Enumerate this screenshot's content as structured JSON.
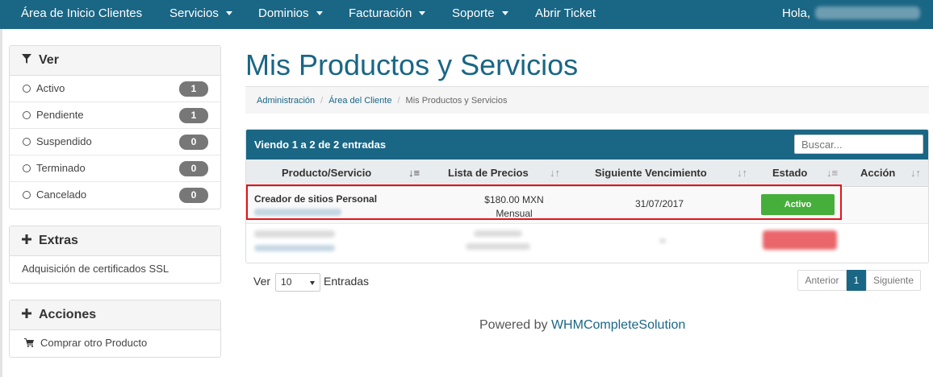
{
  "nav": {
    "home": "Área de Inicio Clientes",
    "services": "Servicios",
    "domains": "Dominios",
    "billing": "Facturación",
    "support": "Soporte",
    "open_ticket": "Abrir Ticket",
    "greeting": "Hola,"
  },
  "sidebar": {
    "view": {
      "title": "Ver",
      "filters": [
        {
          "label": "Activo",
          "count": "1"
        },
        {
          "label": "Pendiente",
          "count": "1"
        },
        {
          "label": "Suspendido",
          "count": "0"
        },
        {
          "label": "Terminado",
          "count": "0"
        },
        {
          "label": "Cancelado",
          "count": "0"
        }
      ]
    },
    "extras": {
      "title": "Extras",
      "item": "Adquisición de certificados SSL"
    },
    "actions": {
      "title": "Acciones",
      "item": "Comprar otro Producto"
    }
  },
  "main": {
    "title": "Mis Productos y Servicios",
    "breadcrumb": [
      "Administración",
      "Área del Cliente",
      "Mis Productos y Servicios"
    ],
    "table_info": "Viendo 1 a 2 de 2 entradas",
    "search_placeholder": "Buscar...",
    "columns": [
      "Producto/Servicio",
      "Lista de Precios",
      "Siguiente Vencimiento",
      "Estado",
      "Acción"
    ],
    "rows": [
      {
        "product": "Creador de sitios Personal",
        "price": "$180.00 MXN",
        "cycle": "Mensual",
        "due": "31/07/2017",
        "status": "Activo",
        "status_color": "#46ae3b"
      }
    ],
    "length_label_before": "Ver",
    "length_value": "10",
    "length_label_after": "Entradas",
    "pagination": {
      "prev": "Anterior",
      "page": "1",
      "next": "Siguiente"
    }
  },
  "footer": {
    "powered_prefix": "Powered by",
    "powered_link": "WHMCompleteSolution"
  },
  "colors": {
    "brand": "#1a6685",
    "highlight": "#e3141a"
  }
}
